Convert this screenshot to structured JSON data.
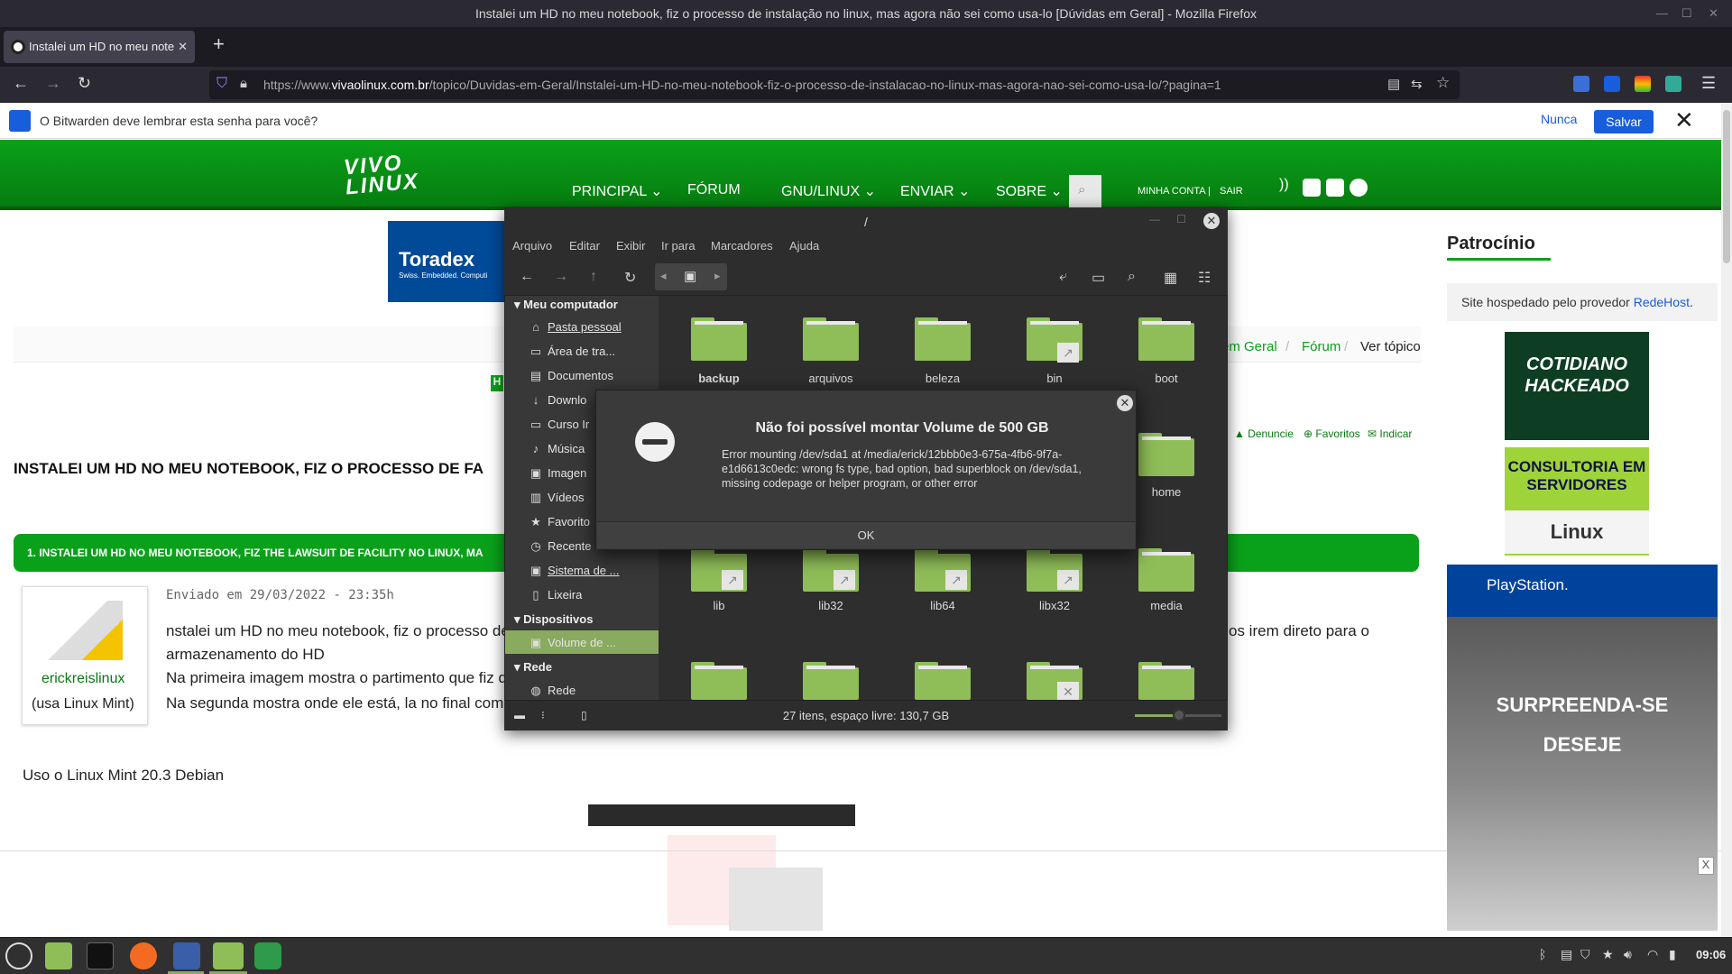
{
  "window": {
    "title": "Instalei um HD no meu notebook, fiz o processo de instalação no linux, mas agora não sei como usa-lo [Dúvidas em Geral] - Mozilla Firefox"
  },
  "browser": {
    "tab_title": "Instalei um HD no meu note",
    "tab_close": "✕",
    "new_tab": "+",
    "url_prefix": "https://www.",
    "url_domain": "vivaolinux.com.br",
    "url_path": "/topico/Duvidas-em-Geral/Instalei-um-HD-no-meu-notebook-fiz-o-processo-de-instalacao-no-linux-mas-agora-nao-sei-como-usa-lo/?pagina=1"
  },
  "bitwarden": {
    "prompt": "O Bitwarden deve lembrar esta senha para você?",
    "never_label": "Nunca",
    "save_label": "Salvar",
    "close_label": "✕"
  },
  "site": {
    "logo": "VIVA O LINUX",
    "logo_line1": "VIVO",
    "logo_line2": "LINUX",
    "menu": [
      "PRINCIPAL ⌄",
      "FÓRUM",
      "GNU/LINUX ⌄",
      "ENVIAR ⌄",
      "SOBRE ⌄"
    ],
    "account": "MINHA CONTA |",
    "logout": "SAIR"
  },
  "page": {
    "toradex": "Toradex",
    "toradex_tag": "Swiss. Embedded. Computi",
    "breadcrumb": [
      "em Geral",
      "Fórum",
      "Ver tópico"
    ],
    "actions": [
      "Denuncie",
      "Favoritos",
      "Indicar"
    ],
    "heading": "INSTALEI UM HD NO MEU NOTEBOOK, FIZ O PROCESSO DE FA",
    "post_bar": "1. INSTALEI UM HD NO MEU NOTEBOOK, FIZ THE LAWSUIT DE FACILITY NO LINUX, MA",
    "author": "erickreislinux",
    "author_distro": "(usa Linux Mint)",
    "posted": "Enviado em 29/03/2022 - 23:35h",
    "body": [
      "nstalei um HD no meu notebook, fiz o processo de",
      "e1d6613c0edc",
      "armazenamento do HD",
      "Na primeira imagem mostra o partimento que fiz d",
      "Na segunda mostra onde ele está, la no final como"
    ],
    "body_right": "os irem direto para o",
    "footer_text": "Uso o Linux Mint 20.3 Debian"
  },
  "sidebar": {
    "title": "Patrocínio",
    "host_text": "Site hospedado pelo provedor ",
    "host_link": "RedeHost",
    "ad1": "COTIDIANO HACKEADO",
    "ad2": "CONSULTORIA EM SERVIDORES",
    "ad2_sub": "Linux",
    "ad3_brand": "PlayStation.",
    "ad3_line1": "SURPREENDA-SE",
    "ad3_line2": "DESEJE",
    "ad3_close": "X"
  },
  "filemanager": {
    "title": "/",
    "menu": [
      "Arquivo",
      "Editar",
      "Exibir",
      "Ir para",
      "Marcadores",
      "Ajuda"
    ],
    "sections": [
      "Meu computador",
      "Dispositivos",
      "Rede"
    ],
    "places": [
      {
        "icon": "⌂",
        "label": "Pasta pessoal"
      },
      {
        "icon": "▭",
        "label": "Área de tra..."
      },
      {
        "icon": "▤",
        "label": "Documentos"
      },
      {
        "icon": "↓",
        "label": "Downlo"
      },
      {
        "icon": "▭",
        "label": "Curso Ir"
      },
      {
        "icon": "♪",
        "label": "Música"
      },
      {
        "icon": "▣",
        "label": "Imagen"
      },
      {
        "icon": "▥",
        "label": "Vídeos"
      },
      {
        "icon": "★",
        "label": "Favorito"
      },
      {
        "icon": "◷",
        "label": "Recente"
      },
      {
        "icon": "▣",
        "label": "Sistema de ..."
      },
      {
        "icon": "▯",
        "label": "Lixeira"
      }
    ],
    "device": {
      "icon": "▣",
      "label": "Volume de ..."
    },
    "network": {
      "icon": "◍",
      "label": "Rede"
    },
    "folders": [
      {
        "name": "backup",
        "link": false,
        "bold": true
      },
      {
        "name": "arquivos",
        "link": false
      },
      {
        "name": "beleza",
        "link": false
      },
      {
        "name": "bin",
        "link": true
      },
      {
        "name": "boot",
        "link": false
      },
      {
        "name": "home",
        "link": false
      },
      {
        "name": "lib",
        "link": true
      },
      {
        "name": "lib32",
        "link": true
      },
      {
        "name": "lib64",
        "link": true
      },
      {
        "name": "libx32",
        "link": true
      },
      {
        "name": "media",
        "link": false
      }
    ],
    "status": "27 itens, espaço livre: 130,7 GB"
  },
  "dialog": {
    "title": "Não foi possível montar Volume de 500 GB",
    "message": "Error mounting /dev/sda1 at /media/erick/12bbb0e3-675a-4fb6-9f7a-e1d6613c0edc: wrong fs type, bad option, bad superblock on /dev/sda1, missing codepage or helper program, or other error",
    "ok_label": "OK",
    "close": "✕"
  },
  "taskbar": {
    "clock": "09:06"
  },
  "colors": {
    "site_green": "#0aa11a",
    "mint_accent": "#8aaa5f",
    "folder_green": "#8fbe58",
    "bitwarden_blue": "#175ddc"
  }
}
